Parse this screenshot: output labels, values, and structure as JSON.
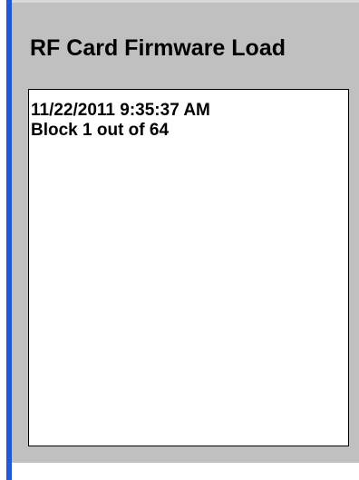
{
  "window": {
    "title": "RF Card Firmware Load"
  },
  "log": {
    "lines": [
      "11/22/2011 9:35:37 AM",
      "Block 1 out of 64"
    ]
  },
  "colors": {
    "panel_background": "#c0c0c0",
    "accent_border": "#2457d6",
    "log_background": "#ffffff",
    "text": "#000000"
  }
}
